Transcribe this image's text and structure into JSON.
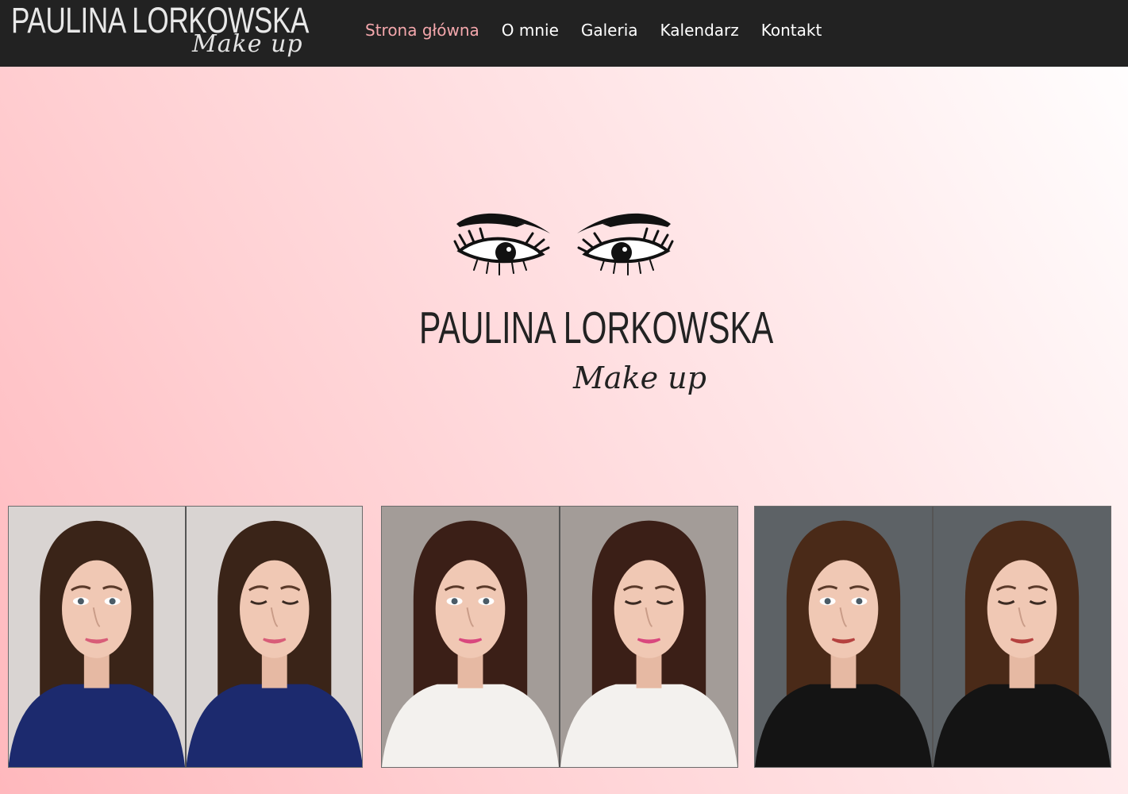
{
  "logo": {
    "brand": "PAULINA LORKOWSKA",
    "tagline": "Make up"
  },
  "nav": {
    "items": [
      {
        "label": "Strona główna",
        "active": true
      },
      {
        "label": "O mnie",
        "active": false
      },
      {
        "label": "Galeria",
        "active": false
      },
      {
        "label": "Kalendarz",
        "active": false
      },
      {
        "label": "Kontakt",
        "active": false
      }
    ]
  },
  "hero": {
    "title": "PAULINA LORKOWSKA",
    "tagline": "Make up",
    "graphic": "eyes-lashes-icon"
  },
  "gallery": {
    "photos": [
      {
        "name": "makeup-photo-1",
        "backdrop": "#d9d4d2",
        "outfit": "#1c2a6e",
        "hair": "#3a2418",
        "lips": "#d85c78"
      },
      {
        "name": "makeup-photo-2",
        "backdrop": "#a39c98",
        "outfit": "#f3f1ee",
        "hair": "#3b1f17",
        "lips": "#d9477e"
      },
      {
        "name": "makeup-photo-3",
        "backdrop": "#5d6266",
        "outfit": "#141414",
        "hair": "#4a2a18",
        "lips": "#b5413f"
      }
    ]
  },
  "colors": {
    "topbar": "#222222",
    "nav_active": "#f4a7ac",
    "nav_text": "#ffffff"
  }
}
